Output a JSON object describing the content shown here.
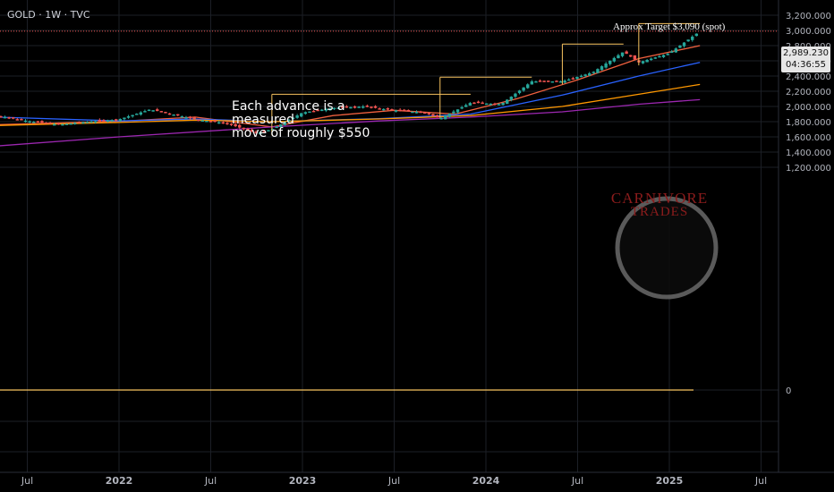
{
  "header": {
    "symbol_line": "GOLD · 1W · TVC"
  },
  "annotations": {
    "measured_move_line1": "Each advance is a measured",
    "measured_move_line2": "move of roughly $550",
    "target": "Approx Target $3,090 (spot)"
  },
  "price_box": {
    "price": "2,989.230",
    "countdown": "04:36:55"
  },
  "watermark": {
    "line1": "CARNIVORE",
    "line2": "TRADES"
  },
  "colors": {
    "up": "#26a69a",
    "down": "#ef5350",
    "ema_fast": "#f2613f",
    "ema_mid": "#2962ff",
    "ema_slow": "#ff9800",
    "ema_long": "#9c27b0",
    "annotation": "#f7c35f",
    "grid": "#1c1f26"
  },
  "chart_data": {
    "type": "line",
    "title": "GOLD · 1W · TVC",
    "y_ticks": [
      "3,200.000",
      "3,000.000",
      "2,800.000",
      "2,600.000",
      "2,400.000",
      "2,200.000",
      "2,000.000",
      "1,800.000",
      "1,600.000",
      "1,400.000",
      "1,200.000",
      "0"
    ],
    "x_ticks": [
      "Jul",
      "2022",
      "Jul",
      "2023",
      "Jul",
      "2024",
      "Jul",
      "2025",
      "Jul"
    ],
    "ylim": [
      1200,
      3200
    ],
    "last_price": 2989.23,
    "series": [
      {
        "name": "",
        "points": [
          [
            "2021-05",
            1880
          ],
          [
            "2021-07",
            1810
          ],
          [
            "2021-09",
            1760
          ],
          [
            "2021-11",
            1800
          ],
          [
            "2022-01",
            1830
          ],
          [
            "2022-03",
            1960
          ],
          [
            "2022-04",
            1920
          ],
          [
            "2022-06",
            1830
          ],
          [
            "2022-08",
            1780
          ],
          [
            "2022-10",
            1650
          ],
          [
            "2022-11",
            1700
          ],
          [
            "2023-01",
            1920
          ],
          [
            "2023-03",
            1980
          ],
          [
            "2023-05",
            2000
          ],
          [
            "2023-07",
            1950
          ],
          [
            "2023-09",
            1920
          ],
          [
            "2023-10",
            1840
          ],
          [
            "2023-12",
            2050
          ],
          [
            "2024-02",
            2030
          ],
          [
            "2024-04",
            2330
          ],
          [
            "2024-06",
            2330
          ],
          [
            "2024-08",
            2450
          ],
          [
            "2024-10",
            2720
          ],
          [
            "2024-11",
            2580
          ],
          [
            "2025-01",
            2700
          ],
          [
            "2025-03",
            2990
          ]
        ]
      },
      {
        "name": "",
        "points": [
          [
            "2021-05",
            1760
          ],
          [
            "2022-01",
            1805
          ],
          [
            "2022-06",
            1860
          ],
          [
            "2022-11",
            1730
          ],
          [
            "2023-03",
            1880
          ],
          [
            "2023-07",
            1950
          ],
          [
            "2023-11",
            1900
          ],
          [
            "2024-03",
            2100
          ],
          [
            "2024-07",
            2350
          ],
          [
            "2024-11",
            2630
          ],
          [
            "2025-03",
            2800
          ]
        ]
      },
      {
        "name": "",
        "points": [
          [
            "2021-05",
            1860
          ],
          [
            "2022-01",
            1810
          ],
          [
            "2022-06",
            1835
          ],
          [
            "2022-11",
            1800
          ],
          [
            "2023-06",
            1840
          ],
          [
            "2023-12",
            1900
          ],
          [
            "2024-06",
            2150
          ],
          [
            "2024-11",
            2400
          ],
          [
            "2025-03",
            2580
          ]
        ]
      },
      {
        "name": "",
        "points": [
          [
            "2021-05",
            1750
          ],
          [
            "2022-01",
            1790
          ],
          [
            "2022-06",
            1820
          ],
          [
            "2022-11",
            1800
          ],
          [
            "2023-06",
            1835
          ],
          [
            "2023-12",
            1880
          ],
          [
            "2024-06",
            2000
          ],
          [
            "2024-11",
            2160
          ],
          [
            "2025-03",
            2290
          ]
        ]
      },
      {
        "name": "",
        "points": [
          [
            "2021-05",
            1480
          ],
          [
            "2022-01",
            1600
          ],
          [
            "2022-11",
            1730
          ],
          [
            "2023-06",
            1810
          ],
          [
            "2023-12",
            1860
          ],
          [
            "2024-06",
            1930
          ],
          [
            "2024-11",
            2030
          ],
          [
            "2025-03",
            2090
          ]
        ]
      }
    ],
    "bracket_annotations": [
      {
        "start": "2022-11",
        "end": "2023-12",
        "low": 1620,
        "high": 2160
      },
      {
        "start": "2023-10",
        "end": "2024-04",
        "low": 1850,
        "high": 2385
      },
      {
        "start": "2024-06",
        "end": "2024-10",
        "low": 2290,
        "high": 2820
      },
      {
        "start": "2024-11",
        "end": "2025-03",
        "low": 2540,
        "high": 3090
      }
    ]
  }
}
